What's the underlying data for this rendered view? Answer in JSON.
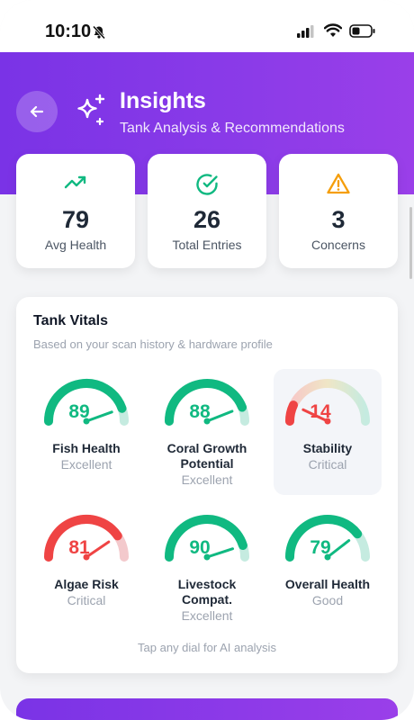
{
  "status_bar": {
    "time": "10:10"
  },
  "header": {
    "title": "Insights",
    "subtitle": "Tank Analysis & Recommendations"
  },
  "stats": [
    {
      "value": "79",
      "label": "Avg Health",
      "icon": "trending-up-icon",
      "color": "#10b981"
    },
    {
      "value": "26",
      "label": "Total Entries",
      "icon": "check-circle-icon",
      "color": "#10b981"
    },
    {
      "value": "3",
      "label": "Concerns",
      "icon": "warning-icon",
      "color": "#f59e0b"
    }
  ],
  "vitals": {
    "title": "Tank Vitals",
    "subtitle": "Based on your scan history & hardware profile",
    "hint": "Tap any dial for AI analysis",
    "gauges": [
      {
        "value": 89,
        "label": "Fish Health",
        "status": "Excellent",
        "color": "#10b981"
      },
      {
        "value": 88,
        "label": "Coral Growth Potential",
        "status": "Excellent",
        "color": "#10b981"
      },
      {
        "value": 14,
        "label": "Stability",
        "status": "Critical",
        "color": "#ef4444"
      },
      {
        "value": 81,
        "label": "Algae Risk",
        "status": "Critical",
        "color": "#ef4444"
      },
      {
        "value": 90,
        "label": "Livestock Compat.",
        "status": "Excellent",
        "color": "#10b981"
      },
      {
        "value": 79,
        "label": "Overall Health",
        "status": "Good",
        "color": "#10b981"
      }
    ]
  },
  "colors": {
    "accent": "#8b3be8",
    "good": "#10b981",
    "bad": "#ef4444",
    "warn": "#f59e0b"
  }
}
